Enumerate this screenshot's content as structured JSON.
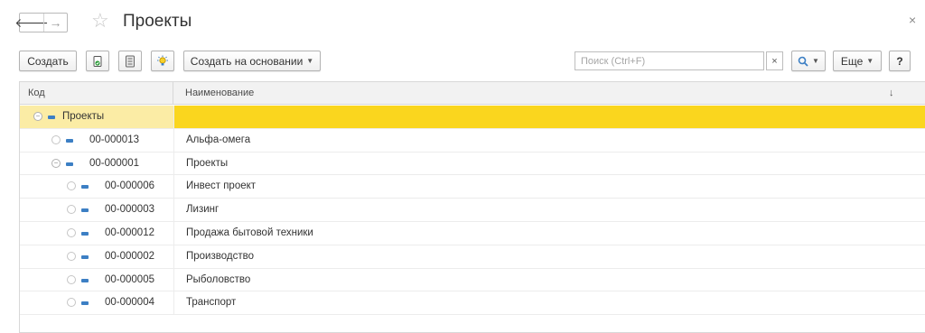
{
  "window": {
    "title": "Проекты",
    "close_glyph": "×",
    "back_glyph": "🡐",
    "forward_glyph": "→",
    "star_glyph": "☆"
  },
  "toolbar": {
    "create_label": "Создать",
    "create_based_label": "Создать на основании",
    "search_placeholder": "Поиск (Ctrl+F)",
    "clear_glyph": "×",
    "more_label": "Еще",
    "help_label": "?"
  },
  "grid": {
    "columns": [
      "Код",
      "Наименование"
    ],
    "sort_glyph": "↓",
    "rows": [
      {
        "code": "Проекты",
        "name": "",
        "level": 0,
        "toggle": "minus",
        "selected": true
      },
      {
        "code": "00-000013",
        "name": "Альфа-омега",
        "level": 1,
        "toggle": "leaf",
        "selected": false
      },
      {
        "code": "00-000001",
        "name": "Проекты",
        "level": 1,
        "toggle": "minus",
        "selected": false
      },
      {
        "code": "00-000006",
        "name": "Инвест проект",
        "level": 2,
        "toggle": "leaf",
        "selected": false
      },
      {
        "code": "00-000003",
        "name": "Лизинг",
        "level": 2,
        "toggle": "leaf",
        "selected": false
      },
      {
        "code": "00-000012",
        "name": "Продажа бытовой техники",
        "level": 2,
        "toggle": "leaf",
        "selected": false
      },
      {
        "code": "00-000002",
        "name": "Производство",
        "level": 2,
        "toggle": "leaf",
        "selected": false
      },
      {
        "code": "00-000005",
        "name": "Рыболовство",
        "level": 2,
        "toggle": "leaf",
        "selected": false
      },
      {
        "code": "00-000004",
        "name": "Транспорт",
        "level": 2,
        "toggle": "leaf",
        "selected": false
      }
    ]
  },
  "colors": {
    "selected_row": "#fad61e",
    "selected_code_cell": "#fbeca5",
    "accent_blue": "#3c7fc4"
  },
  "icons": [
    "back-arrow-icon",
    "forward-arrow-icon",
    "star-icon",
    "close-icon",
    "copy-item-icon",
    "list-icon",
    "bulb-icon",
    "search-icon",
    "clear-icon",
    "chevron-down-icon",
    "tree-collapse-icon",
    "tree-leaf-icon",
    "item-dash-icon",
    "sort-down-icon"
  ]
}
